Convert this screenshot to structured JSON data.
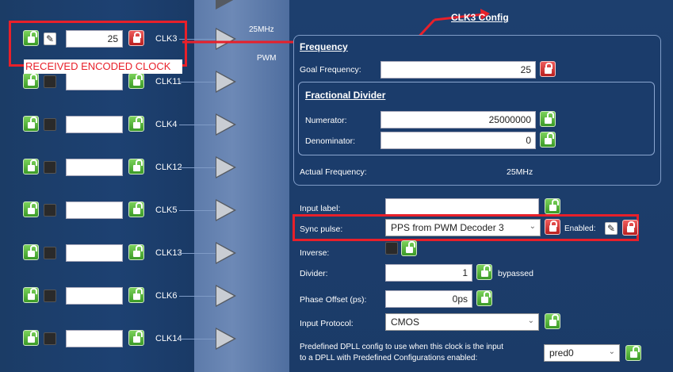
{
  "annotation": {
    "title": "CLK3 Config",
    "received_label": "RECEIVED ENCODED CLOCK"
  },
  "clock_rows": [
    {
      "name": "CLK3",
      "value": "25",
      "locked": true,
      "checked": true
    },
    {
      "name": "CLK11",
      "value": "",
      "locked": false,
      "checked": false
    },
    {
      "name": "CLK4",
      "value": "",
      "locked": false,
      "checked": false
    },
    {
      "name": "CLK12",
      "value": "",
      "locked": false,
      "checked": false
    },
    {
      "name": "CLK5",
      "value": "",
      "locked": false,
      "checked": false
    },
    {
      "name": "CLK13",
      "value": "",
      "locked": false,
      "checked": false
    },
    {
      "name": "CLK6",
      "value": "",
      "locked": false,
      "checked": false
    },
    {
      "name": "CLK14",
      "value": "",
      "locked": false,
      "checked": false
    }
  ],
  "mid": {
    "freq_label": "25MHz",
    "mode_label": "PWM"
  },
  "frequency": {
    "title": "Frequency",
    "goal_label": "Goal Frequency:",
    "goal_value": "25",
    "fractional_title": "Fractional Divider",
    "numerator_label": "Numerator:",
    "numerator_value": "25000000",
    "denominator_label": "Denominator:",
    "denominator_value": "0",
    "actual_label": "Actual Frequency:",
    "actual_value": "25MHz"
  },
  "settings": {
    "input_label": "Input label:",
    "input_value": "",
    "sync_label": "Sync pulse:",
    "sync_value": "PPS from PWM Decoder 3",
    "enabled_label": "Enabled:",
    "inverse_label": "Inverse:",
    "divider_label": "Divider:",
    "divider_value": "1",
    "bypassed_label": "bypassed",
    "phase_label": "Phase Offset (ps):",
    "phase_value": "0ps",
    "protocol_label": "Input Protocol:",
    "protocol_value": "CMOS",
    "predefined_label_line1": "Predefined DPLL config to use when this clock is the input",
    "predefined_label_line2": "to a DPLL with Predefined Configurations enabled:",
    "predefined_value": "pred0"
  },
  "colors": {
    "accent_red": "#e8202a",
    "lock_green": "#3b9a27",
    "lock_red": "#b81f1f",
    "panel_blue": "#1d3f6e"
  }
}
